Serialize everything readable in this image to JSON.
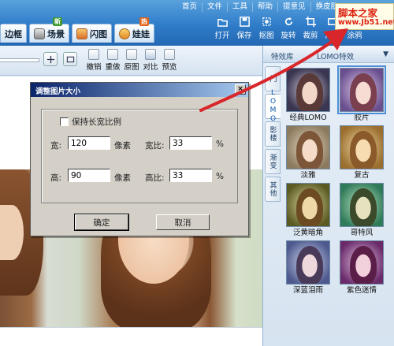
{
  "menu": [
    "首页",
    "文件",
    "工具",
    "帮助",
    "提意见",
    "换皮肤"
  ],
  "tabs": [
    {
      "label": "边框",
      "icon": "frame-icon"
    },
    {
      "label": "场景",
      "icon": "scene-icon",
      "badge": "新"
    },
    {
      "label": "闪图",
      "icon": "flash-icon"
    },
    {
      "label": "娃娃",
      "icon": "doll-icon",
      "badge": "热"
    }
  ],
  "tools": [
    {
      "label": "打开",
      "icon": "open-icon"
    },
    {
      "label": "保存",
      "icon": "save-icon"
    },
    {
      "label": "抠图",
      "icon": "cutout-icon"
    },
    {
      "label": "旋转",
      "icon": "rotate-icon"
    },
    {
      "label": "裁剪",
      "icon": "crop-icon"
    },
    {
      "label": "尺寸",
      "icon": "size-icon"
    },
    {
      "label": "涂鸦",
      "icon": "doodle-icon"
    }
  ],
  "watermark": {
    "line1": "脚本之家",
    "line2": "www.Jb51.net"
  },
  "edit_tools": [
    {
      "label": "撤销",
      "icon": "undo-icon"
    },
    {
      "label": "重做",
      "icon": "redo-icon"
    },
    {
      "label": "原图",
      "icon": "original-icon"
    },
    {
      "label": "对比",
      "icon": "compare-icon"
    },
    {
      "label": "预览",
      "icon": "preview-icon"
    }
  ],
  "panel": {
    "tab1": "特效库",
    "tab2": "LOMO特效",
    "side_tabs": [
      "门",
      "LOMO",
      "影楼",
      "渐变",
      "其他"
    ],
    "effects": [
      {
        "label": "经典LOMO"
      },
      {
        "label": "胶片"
      },
      {
        "label": "淡雅"
      },
      {
        "label": "复古"
      },
      {
        "label": "泛黄暗角"
      },
      {
        "label": "哥特风"
      },
      {
        "label": "深蓝泪雨"
      },
      {
        "label": "紫色迷情"
      }
    ]
  },
  "dialog": {
    "title": "调整图片大小",
    "close": "×",
    "keep_ratio": "保持长宽比例",
    "width_label": "宽:",
    "width_value": "120",
    "width_unit": "像素",
    "width_ratio_label": "宽比:",
    "width_ratio_value": "33",
    "width_ratio_unit": "%",
    "height_label": "高:",
    "height_value": "90",
    "height_unit": "像素",
    "height_ratio_label": "高比:",
    "height_ratio_value": "33",
    "height_ratio_unit": "%",
    "ok": "确定",
    "cancel": "取消"
  }
}
